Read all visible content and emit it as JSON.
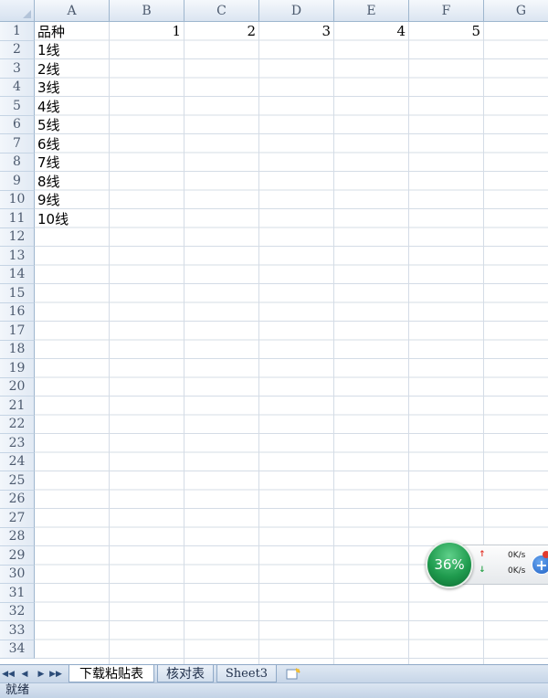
{
  "columns": [
    "A",
    "B",
    "C",
    "D",
    "E",
    "F",
    "G"
  ],
  "rows": [
    "1",
    "2",
    "3",
    "4",
    "5",
    "6",
    "7",
    "8",
    "9",
    "10",
    "11",
    "12",
    "13",
    "14",
    "15",
    "16",
    "17",
    "18",
    "19",
    "20",
    "21",
    "22",
    "23",
    "24",
    "25",
    "26",
    "27",
    "28",
    "29",
    "30",
    "31",
    "32",
    "33",
    "34"
  ],
  "cells": {
    "a1": "品种",
    "b1": "1",
    "c1": "2",
    "d1": "3",
    "e1": "4",
    "f1": "5",
    "a2": "1线",
    "a3": "2线",
    "a4": "3线",
    "a5": "4线",
    "a6": "5线",
    "a7": "6线",
    "a8": "7线",
    "a9": "8线",
    "a10": "9线",
    "a11": "10线"
  },
  "sheet_tabs": [
    "下载粘贴表",
    "核对表",
    "Sheet3"
  ],
  "active_tab": "下载粘贴表",
  "status_text": "就绪",
  "speed_widget": {
    "percent": "36%",
    "upload": "0K/s",
    "download": "0K/s",
    "upload_color": "#e2352a",
    "download_color": "#2aa34a"
  }
}
